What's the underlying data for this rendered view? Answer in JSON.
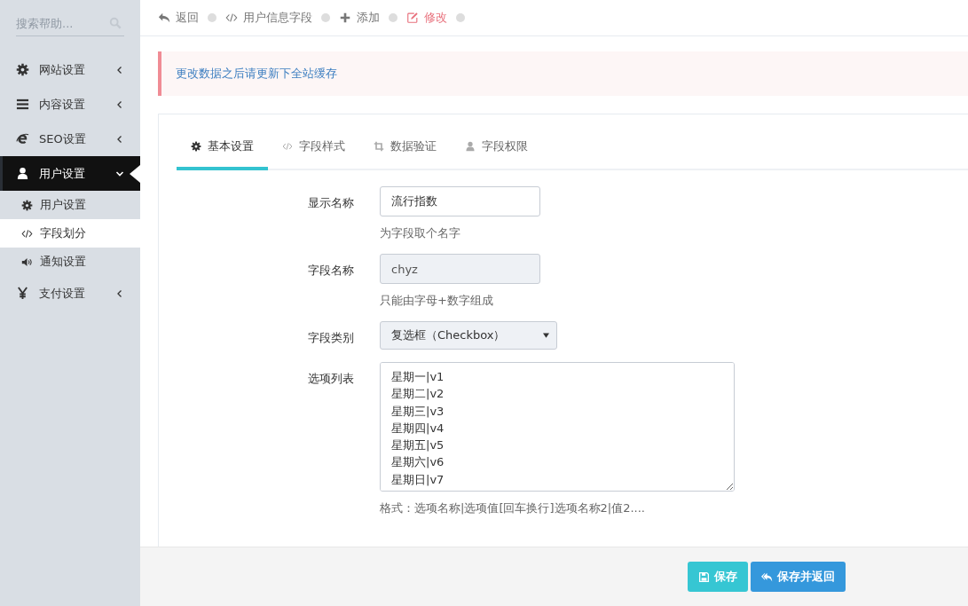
{
  "sidebar": {
    "search": {
      "placeholder": "搜索帮助..."
    },
    "items": [
      {
        "label": "网站设置",
        "expanded": false
      },
      {
        "label": "内容设置",
        "expanded": false
      },
      {
        "label": "SEO设置",
        "expanded": false
      },
      {
        "label": "用户设置",
        "expanded": true,
        "children": [
          {
            "label": "用户设置",
            "selected": false
          },
          {
            "label": "字段划分",
            "selected": true
          },
          {
            "label": "通知设置",
            "selected": false
          }
        ]
      },
      {
        "label": "支付设置",
        "expanded": false
      }
    ]
  },
  "breadcrumb": [
    {
      "label": "返回",
      "selected": false
    },
    {
      "label": "用户信息字段",
      "selected": false
    },
    {
      "label": "添加",
      "selected": false
    },
    {
      "label": "修改",
      "selected": true
    }
  ],
  "alert": "更改数据之后请更新下全站缓存",
  "tabs": [
    {
      "label": "基本设置",
      "selected": true
    },
    {
      "label": "字段样式",
      "selected": false
    },
    {
      "label": "数据验证",
      "selected": false
    },
    {
      "label": "字段权限",
      "selected": false
    }
  ],
  "form": [
    {
      "kind": "input",
      "label": "显示名称",
      "value": "流行指数",
      "disabled": false,
      "hint": "为字段取个名字"
    },
    {
      "kind": "input",
      "label": "字段名称",
      "value": "chyz",
      "disabled": true,
      "hint": "只能由字母+数字组成"
    },
    {
      "kind": "select",
      "label": "字段类别",
      "value": "复选框（Checkbox）"
    },
    {
      "kind": "textarea",
      "label": "选项列表",
      "value": "星期一|v1\n星期二|v2\n星期三|v3\n星期四|v4\n星期五|v5\n星期六|v6\n星期日|v7",
      "hint": "格式：选项名称|选项值[回车换行]选项名称2|值2...."
    }
  ],
  "buttons": [
    {
      "label": "保存",
      "kind": "info"
    },
    {
      "label": "保存并返回",
      "kind": "primary"
    }
  ]
}
